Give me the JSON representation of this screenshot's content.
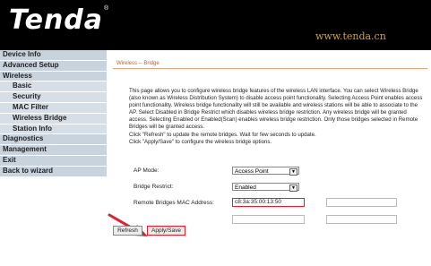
{
  "header": {
    "logo_text": "Tenda",
    "logo_mark": "®",
    "site_url": "www.tenda.cn"
  },
  "sidebar": {
    "items": [
      {
        "label": "Device Info"
      },
      {
        "label": "Advanced Setup"
      },
      {
        "label": "Wireless"
      },
      {
        "label": "Basic"
      },
      {
        "label": "Security"
      },
      {
        "label": "MAC Filter"
      },
      {
        "label": "Wireless Bridge"
      },
      {
        "label": "Station Info"
      },
      {
        "label": "Diagnostics"
      },
      {
        "label": "Management"
      },
      {
        "label": "Exit"
      },
      {
        "label": "Back to wizard"
      }
    ]
  },
  "main": {
    "breadcrumb": "Wireless -- Bridge",
    "description": [
      "This page allows you to configure wireless bridge features of the wireless LAN interface. You can select Wireless Bridge (also known as Wireless Distribution System) to disable access point functionality. Selecting Access Point enables access point functionality. Wireless bridge functionality will still be available and wireless stations will be able to associate to the AP. Select Disabled in Bridge Restrict which disables wireless bridge restriction. Any wireless bridge will be granted access. Selecting Enabled or Enabled(Scan) enables wireless bridge restriction. Only those bridges selected in Remote Bridges will be granted access.",
      "Click \"Refresh\" to update the remote bridges. Wait for few seconds to update.",
      "Click \"Apply/Save\" to configure the wireless bridge options."
    ],
    "ap_mode": {
      "label": "AP Mode:",
      "value": "Access Point"
    },
    "bridge_restrict": {
      "label": "Bridge Restrict:",
      "value": "Enabled"
    },
    "remote_mac": {
      "label": "Remote Bridges MAC Address:",
      "values": [
        "c8:3a:35:00:13:50",
        "",
        "",
        ""
      ]
    },
    "buttons": {
      "refresh": "Refresh",
      "apply_save": "Apply/Save"
    },
    "accent_color": "#e02030"
  }
}
